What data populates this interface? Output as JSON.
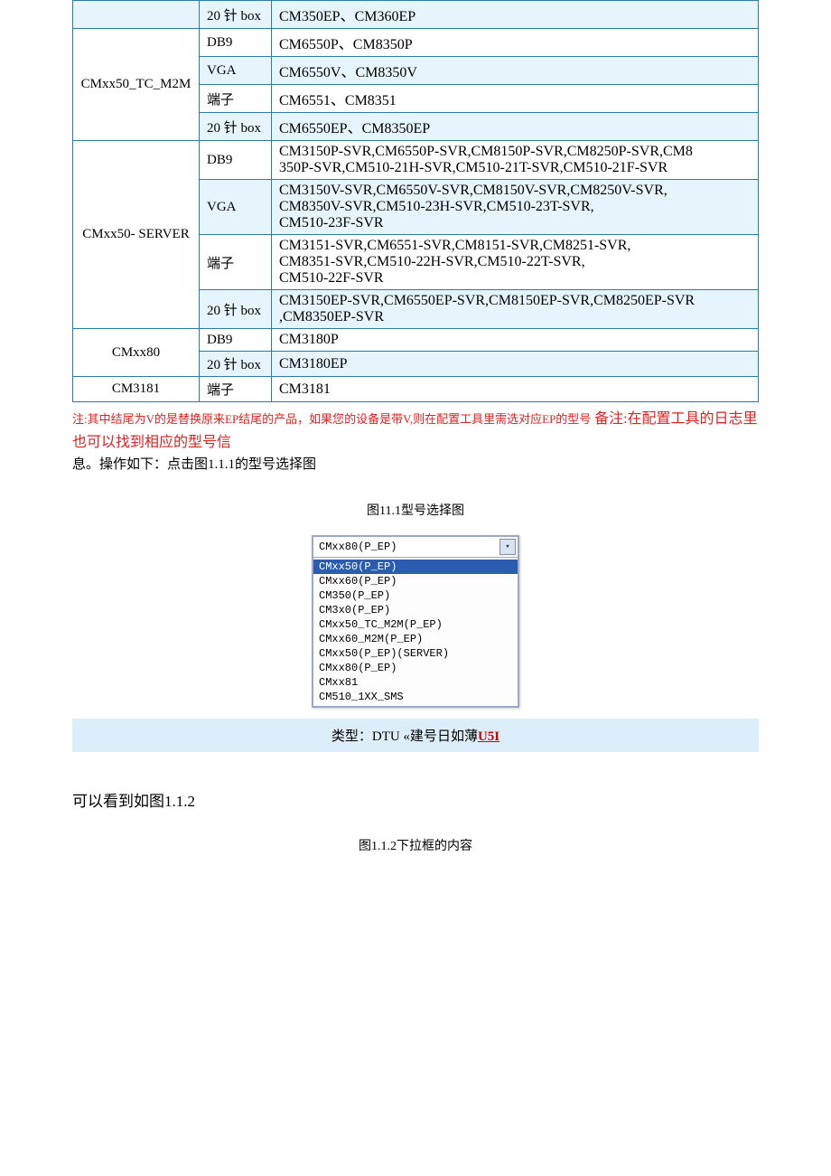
{
  "table": {
    "r0": {
      "c2": "20 针 box",
      "c3": "CM350EP、CM360EP"
    },
    "g1_label": "CMxx50_TC_M2M",
    "g1_r1": {
      "c2": "DB9",
      "c3": "CM6550P、CM8350P"
    },
    "g1_r2": {
      "c2": "VGA",
      "c3": "CM6550V、CM8350V"
    },
    "g1_r3": {
      "c2": "端子",
      "c3": "CM6551、CM8351"
    },
    "g1_r4": {
      "c2": "20 针 box",
      "c3": "CM6550EP、CM8350EP"
    },
    "g2_label": "CMxx50- SERVER",
    "g2_r1": {
      "c2": "DB9",
      "c3": "CM3150P-SVR,CM6550P-SVR,CM8150P-SVR,CM8250P-SVR,CM8\n350P-SVR,CM510-21H-SVR,CM510-21T-SVR,CM510-21F-SVR"
    },
    "g2_r2": {
      "c2": "VGA",
      "c3": "CM3150V-SVR,CM6550V-SVR,CM8150V-SVR,CM8250V-SVR,\nCM8350V-SVR,CM510-23H-SVR,CM510-23T-SVR,\nCM510-23F-SVR"
    },
    "g2_r3": {
      "c2": "端子",
      "c3": "CM3151-SVR,CM6551-SVR,CM8151-SVR,CM8251-SVR,\nCM8351-SVR,CM510-22H-SVR,CM510-22T-SVR,\nCM510-22F-SVR"
    },
    "g2_r4": {
      "c2": "20 针 box",
      "c3": "CM3150EP-SVR,CM6550EP-SVR,CM8150EP-SVR,CM8250EP-SVR\n,CM8350EP-SVR"
    },
    "g3_label": "CMxx80",
    "g3_r1": {
      "c2": "DB9",
      "c3": "CM3180P"
    },
    "g3_r2": {
      "c2": "20 针 box",
      "c3": "CM3180EP"
    },
    "g4_label": "CM3181",
    "g4_r1": {
      "c2": "端子",
      "c3": "CM3181"
    }
  },
  "notes": {
    "red1": "注:其中结尾为V的是替换原来EP结尾的产品，如果您的设备是带V,则在配置工具里需选对应EP的型号",
    "big1": "备注:在配置工具的日志里也可以找到相应的型号信",
    "black_tail": "息。操作如下：点击图1.1.1的型号选择图"
  },
  "fig1_caption": "图11.1型号选择图",
  "dropdown": {
    "selected": "CMxx80(P_EP)",
    "items": [
      "CMxx50(P_EP)",
      "CMxx60(P_EP)",
      "CM350(P_EP)",
      "CM3x0(P_EP)",
      "CMxx50_TC_M2M(P_EP)",
      "CMxx60_M2M(P_EP)",
      "CMxx50(P_EP)(SERVER)",
      "CMxx80(P_EP)",
      "CMxx81",
      "CM510_1XX_SMS"
    ]
  },
  "bottom_band": {
    "label": "类型：DTU «建号日如薄",
    "u": "U5I"
  },
  "see_img_txt": "可以看到如图1.1.2",
  "fig2_caption": "图1.1.2下拉框的内容"
}
